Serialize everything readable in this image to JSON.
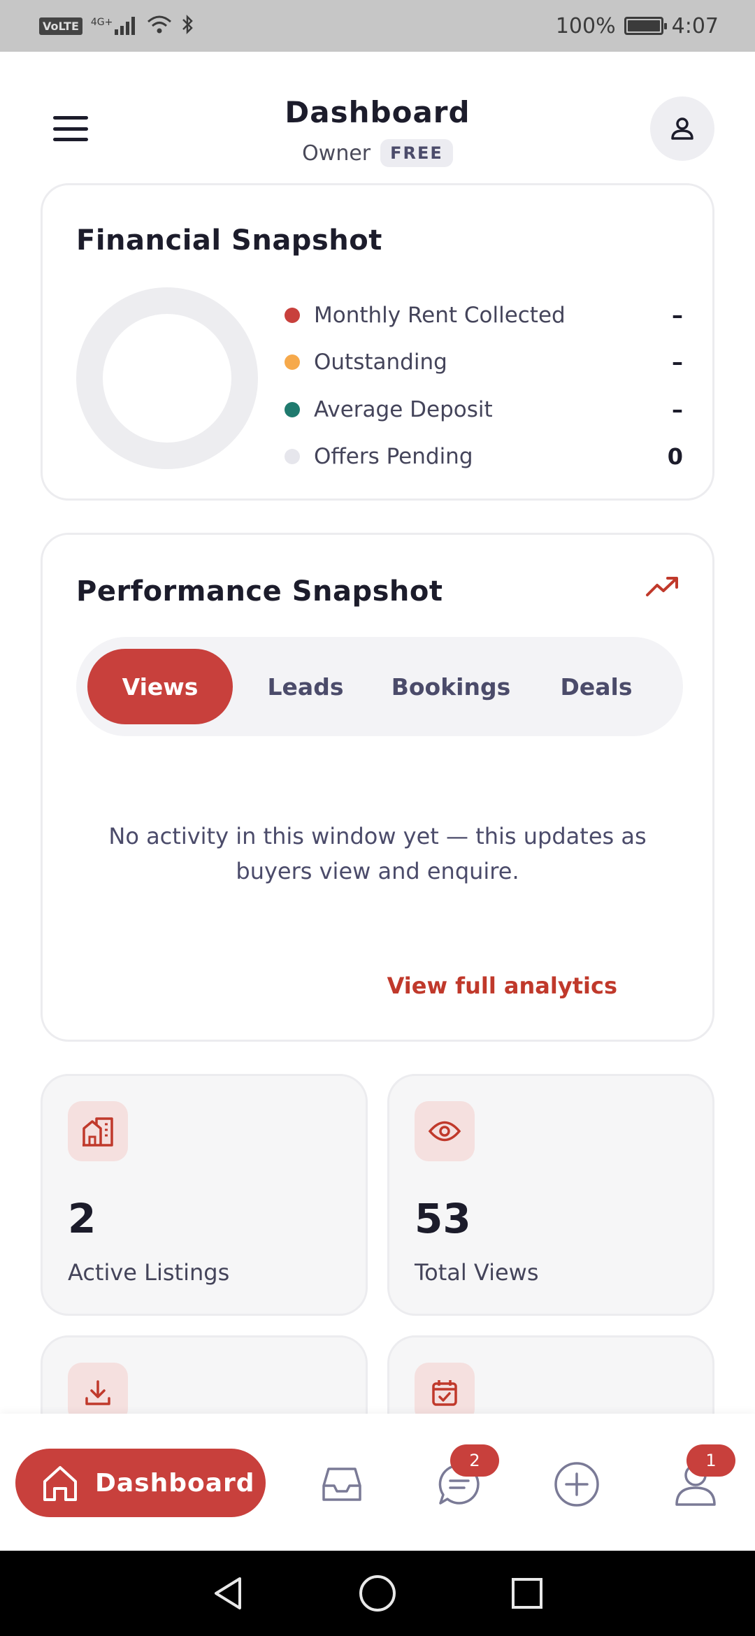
{
  "status_bar": {
    "network": "VoLTE",
    "signal": "4G+",
    "battery": "100%",
    "time": "4:07"
  },
  "header": {
    "title": "Dashboard",
    "role": "Owner",
    "plan": "FREE"
  },
  "financial": {
    "title": "Financial Snapshot",
    "items": [
      {
        "label": "Monthly Rent Collected",
        "value": "–",
        "color": "#c8403c"
      },
      {
        "label": "Outstanding",
        "value": "–",
        "color": "#f6a94b"
      },
      {
        "label": "Average Deposit",
        "value": "–",
        "color": "#1f7a6e"
      },
      {
        "label": "Offers Pending",
        "value": "0",
        "color": "#e6e6ec"
      }
    ]
  },
  "performance": {
    "title": "Performance Snapshot",
    "tabs": [
      "Views",
      "Leads",
      "Bookings",
      "Deals"
    ],
    "active_tab": "Views",
    "empty_message": "No activity in this window yet — this updates as buyers view and enquire.",
    "link": "View full analytics"
  },
  "stats": [
    {
      "value": "2",
      "label": "Active Listings",
      "icon": "building-icon"
    },
    {
      "value": "53",
      "label": "Total Views",
      "icon": "eye-icon"
    },
    {
      "value": "",
      "label": "",
      "icon": "download-icon"
    },
    {
      "value": "",
      "label": "",
      "icon": "calendar-check-icon"
    }
  ],
  "bottom_nav": {
    "home_label": "Dashboard",
    "messages_badge": "2",
    "profile_badge": "1"
  },
  "colors": {
    "accent": "#c8403c",
    "text": "#1c1c2b"
  }
}
